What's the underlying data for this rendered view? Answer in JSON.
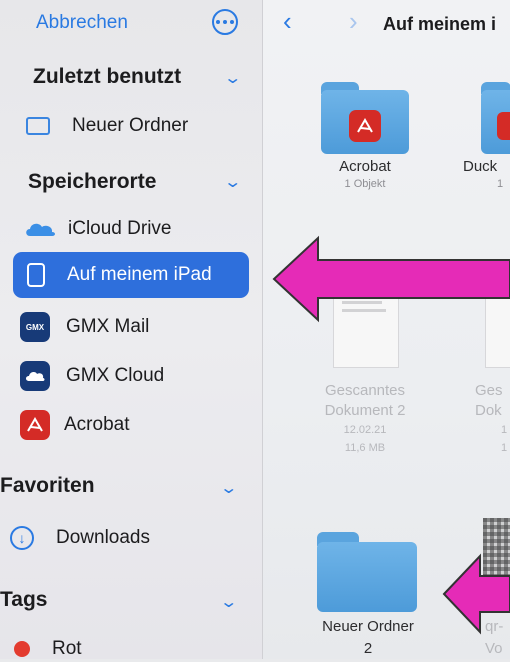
{
  "sidebar": {
    "cancel_label": "Abbrechen",
    "recent": {
      "heading": "Zuletzt benutzt",
      "items": [
        {
          "label": "Neuer Ordner",
          "icon": "folder-outline-icon"
        }
      ]
    },
    "locations": {
      "heading": "Speicherorte",
      "items": [
        {
          "label": "iCloud Drive",
          "icon": "icloud-icon"
        },
        {
          "label": "Auf meinem iPad",
          "icon": "ipad-icon",
          "selected": true
        },
        {
          "label": "GMX Mail",
          "icon": "gmx-mail-icon",
          "badge": "GMX"
        },
        {
          "label": "GMX Cloud",
          "icon": "gmx-cloud-icon"
        },
        {
          "label": "Acrobat",
          "icon": "acrobat-icon"
        }
      ]
    },
    "favorites": {
      "heading": "Favoriten",
      "items": [
        {
          "label": "Downloads",
          "icon": "download-icon"
        }
      ]
    },
    "tags": {
      "heading": "Tags",
      "items": [
        {
          "label": "Rot",
          "color": "#e33b2f"
        }
      ]
    }
  },
  "main": {
    "title": "Auf meinem i",
    "items": [
      {
        "name": "Acrobat",
        "sub": "1 Objekt"
      },
      {
        "name": "Duck",
        "sub": "1"
      },
      {
        "name_line1": "Gescanntes",
        "name_line2": "Dokument 2",
        "date": "12.02.21",
        "size": "11,6 MB"
      },
      {
        "name_line1": "Ges",
        "name_line2": "Dok",
        "date": "1",
        "size": "1"
      },
      {
        "name_line1": "Neuer Ordner",
        "name_line2": "2"
      },
      {
        "name_line1": "qr-",
        "name_line2": "Vo"
      }
    ]
  },
  "colors": {
    "accent": "#2a7ae2",
    "selected_row": "#2e6fdc",
    "annotation_arrow": "#e52bb7",
    "acrobat_red": "#d42b26",
    "gmx_blue": "#173a78"
  }
}
